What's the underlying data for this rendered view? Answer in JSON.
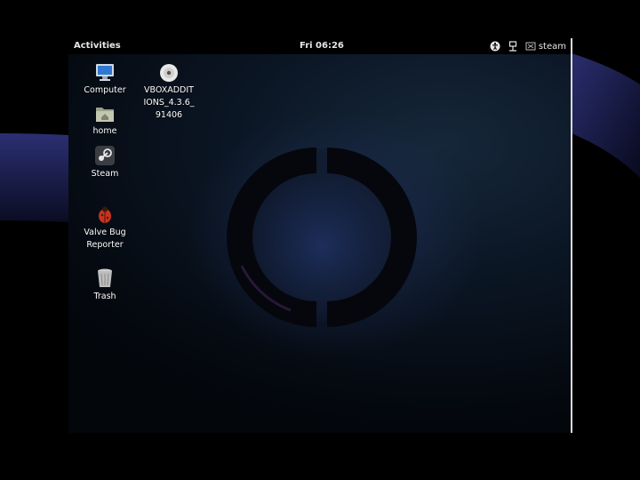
{
  "topbar": {
    "activities_label": "Activities",
    "clock": "Fri 06:26",
    "user_name": "steam",
    "icons": [
      "accessibility-icon",
      "network-icon",
      "user-icon"
    ]
  },
  "desktop": {
    "icons": [
      {
        "name": "computer",
        "label": "Computer",
        "icon": "computer-icon"
      },
      {
        "name": "home",
        "label": "home",
        "icon": "folder-home-icon"
      },
      {
        "name": "steam",
        "label": "Steam",
        "icon": "steam-icon"
      },
      {
        "name": "valve-bug-reporter",
        "label": "Valve Bug\nReporter",
        "icon": "bug-icon"
      },
      {
        "name": "trash",
        "label": "Trash",
        "icon": "trash-icon"
      },
      {
        "name": "vboxadditions",
        "label": "VBOXADDIT\nIONS_4.3.6_\n91406",
        "icon": "disc-icon"
      }
    ]
  },
  "colors": {
    "topbar_bg": "#000000",
    "desktop_bg": "#0b1624",
    "outer_swoosh": "#2a2f6a"
  }
}
